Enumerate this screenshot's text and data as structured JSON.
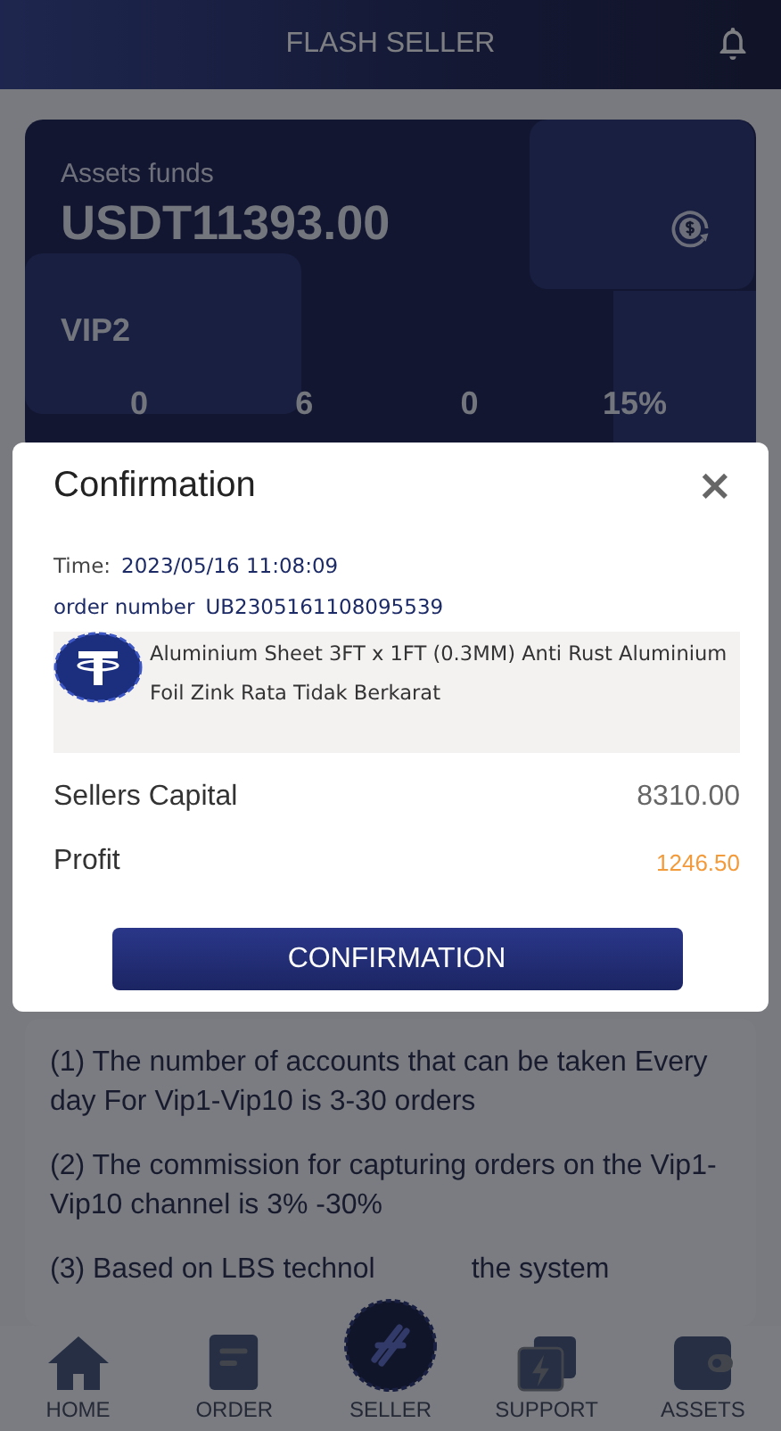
{
  "header": {
    "title": "FLASH SELLER"
  },
  "assets": {
    "label": "Assets funds",
    "amount": "USDT11393.00",
    "vip": "VIP2",
    "stats": [
      {
        "value": "0"
      },
      {
        "value": "6"
      },
      {
        "value": "0"
      },
      {
        "value": "15%"
      }
    ]
  },
  "rules": [
    "(1) The number of accounts that can be taken Every day For Vip1-Vip10 is 3-30 orders",
    "(2) The commission for capturing orders on the Vip1-Vip10 channel is 3% -30%"
  ],
  "rule_cut": [
    "(3) Based on LBS technol",
    "the system"
  ],
  "dialog": {
    "title": "Confirmation",
    "close": "×",
    "time_label": "Time:",
    "time": "2023/05/16 11:08:09",
    "order_label": "order number",
    "order_number": "UB2305161108095539",
    "product": "Aluminium Sheet 3FT x 1FT (0.3MM) Anti Rust Aluminium Foil Zink Rata Tidak Berkarat",
    "rows": [
      {
        "label": "Sellers Capital",
        "value": "8310.00",
        "kind": "plain"
      },
      {
        "label": "Profit",
        "value": "1246.50",
        "kind": "accent"
      }
    ],
    "button": "CONFIRMATION"
  },
  "nav": [
    {
      "label": "HOME",
      "kind": "home"
    },
    {
      "label": "ORDER",
      "kind": "order"
    },
    {
      "label": "SELLER",
      "kind": "seller"
    },
    {
      "label": "SUPPORT",
      "kind": "support"
    },
    {
      "label": "ASSETS",
      "kind": "assets"
    }
  ]
}
